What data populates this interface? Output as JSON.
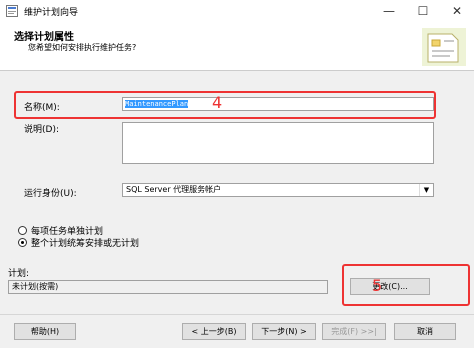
{
  "window": {
    "title": "维护计划向导"
  },
  "header": {
    "title": "选择计划属性",
    "subtitle": "您希望如何安排执行维护任务?"
  },
  "form": {
    "name_label": "名称(M):",
    "name_value": "MaintenancePlan",
    "description_label": "说明(D):",
    "run_as_label": "运行身份(U):",
    "run_as_value": "SQL Server 代理服务帐户"
  },
  "options": [
    {
      "label": "每项任务单独计划",
      "selected": false
    },
    {
      "label": "整个计划统筹安排或无计划",
      "selected": true
    }
  ],
  "schedule": {
    "label": "计划:",
    "value": "未计划(按需)",
    "change_button": "更改(C)..."
  },
  "annotations": {
    "a1": "4",
    "a2": "5"
  },
  "buttons": {
    "help": "帮助(H)",
    "back": "< 上一步(B)",
    "next": "下一步(N) >",
    "finish": "完成(F) >>|",
    "cancel": "取消"
  },
  "colors": {
    "annotation": "#e33333",
    "selection": "#3399ff"
  }
}
